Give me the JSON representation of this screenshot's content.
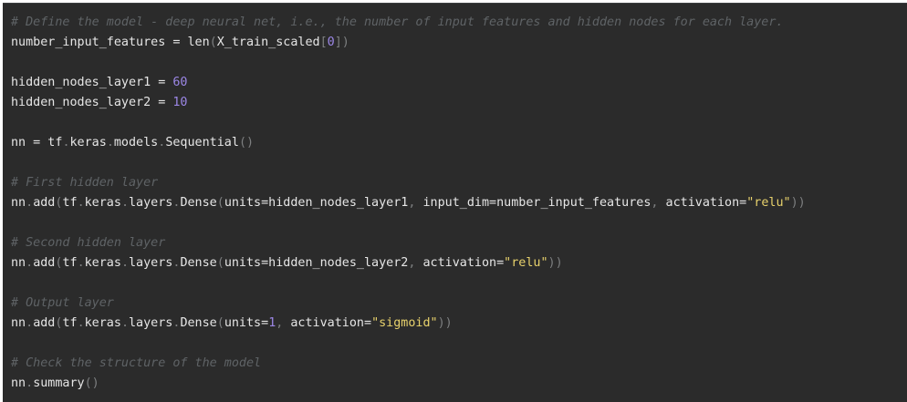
{
  "editor": {
    "lines": [
      [
        {
          "t": "# Define the model - deep neural net, i.e., the number of input features and hidden nodes for each layer.",
          "c": "cm"
        }
      ],
      [
        {
          "t": "number_input_features = len",
          "c": ""
        },
        {
          "t": "(",
          "c": "pn"
        },
        {
          "t": "X_train_scaled",
          "c": ""
        },
        {
          "t": "[",
          "c": "pn"
        },
        {
          "t": "0",
          "c": "num"
        },
        {
          "t": "])",
          "c": "pn"
        }
      ],
      [],
      [
        {
          "t": "hidden_nodes_layer1 = ",
          "c": ""
        },
        {
          "t": "60",
          "c": "num"
        }
      ],
      [
        {
          "t": "hidden_nodes_layer2 = ",
          "c": ""
        },
        {
          "t": "10",
          "c": "num"
        }
      ],
      [],
      [
        {
          "t": "nn = tf",
          "c": ""
        },
        {
          "t": ".",
          "c": "pn"
        },
        {
          "t": "keras",
          "c": ""
        },
        {
          "t": ".",
          "c": "pn"
        },
        {
          "t": "models",
          "c": ""
        },
        {
          "t": ".",
          "c": "pn"
        },
        {
          "t": "Sequential",
          "c": ""
        },
        {
          "t": "()",
          "c": "pn"
        }
      ],
      [],
      [
        {
          "t": "# First hidden layer",
          "c": "cm"
        }
      ],
      [
        {
          "t": "nn",
          "c": ""
        },
        {
          "t": ".",
          "c": "pn"
        },
        {
          "t": "add",
          "c": ""
        },
        {
          "t": "(",
          "c": "pn"
        },
        {
          "t": "tf",
          "c": ""
        },
        {
          "t": ".",
          "c": "pn"
        },
        {
          "t": "keras",
          "c": ""
        },
        {
          "t": ".",
          "c": "pn"
        },
        {
          "t": "layers",
          "c": ""
        },
        {
          "t": ".",
          "c": "pn"
        },
        {
          "t": "Dense",
          "c": ""
        },
        {
          "t": "(",
          "c": "pn"
        },
        {
          "t": "units=hidden_nodes_layer1",
          "c": ""
        },
        {
          "t": ", ",
          "c": "pn"
        },
        {
          "t": "input_dim=number_input_features",
          "c": ""
        },
        {
          "t": ", ",
          "c": "pn"
        },
        {
          "t": "activation=",
          "c": ""
        },
        {
          "t": "\"relu\"",
          "c": "str"
        },
        {
          "t": "))",
          "c": "pn"
        }
      ],
      [],
      [
        {
          "t": "# Second hidden layer",
          "c": "cm"
        }
      ],
      [
        {
          "t": "nn",
          "c": ""
        },
        {
          "t": ".",
          "c": "pn"
        },
        {
          "t": "add",
          "c": ""
        },
        {
          "t": "(",
          "c": "pn"
        },
        {
          "t": "tf",
          "c": ""
        },
        {
          "t": ".",
          "c": "pn"
        },
        {
          "t": "keras",
          "c": ""
        },
        {
          "t": ".",
          "c": "pn"
        },
        {
          "t": "layers",
          "c": ""
        },
        {
          "t": ".",
          "c": "pn"
        },
        {
          "t": "Dense",
          "c": ""
        },
        {
          "t": "(",
          "c": "pn"
        },
        {
          "t": "units=hidden_nodes_layer2",
          "c": ""
        },
        {
          "t": ", ",
          "c": "pn"
        },
        {
          "t": "activation=",
          "c": ""
        },
        {
          "t": "\"relu\"",
          "c": "str"
        },
        {
          "t": "))",
          "c": "pn"
        }
      ],
      [],
      [
        {
          "t": "# Output layer",
          "c": "cm"
        }
      ],
      [
        {
          "t": "nn",
          "c": ""
        },
        {
          "t": ".",
          "c": "pn"
        },
        {
          "t": "add",
          "c": ""
        },
        {
          "t": "(",
          "c": "pn"
        },
        {
          "t": "tf",
          "c": ""
        },
        {
          "t": ".",
          "c": "pn"
        },
        {
          "t": "keras",
          "c": ""
        },
        {
          "t": ".",
          "c": "pn"
        },
        {
          "t": "layers",
          "c": ""
        },
        {
          "t": ".",
          "c": "pn"
        },
        {
          "t": "Dense",
          "c": ""
        },
        {
          "t": "(",
          "c": "pn"
        },
        {
          "t": "units=",
          "c": ""
        },
        {
          "t": "1",
          "c": "num"
        },
        {
          "t": ", ",
          "c": "pn"
        },
        {
          "t": "activation=",
          "c": ""
        },
        {
          "t": "\"sigmoid\"",
          "c": "str"
        },
        {
          "t": "))",
          "c": "pn"
        }
      ],
      [],
      [
        {
          "t": "# Check the structure of the model",
          "c": "cm"
        }
      ],
      [
        {
          "t": "nn",
          "c": ""
        },
        {
          "t": ".",
          "c": "pn"
        },
        {
          "t": "summary",
          "c": ""
        },
        {
          "t": "()",
          "c": "pn"
        }
      ]
    ]
  }
}
